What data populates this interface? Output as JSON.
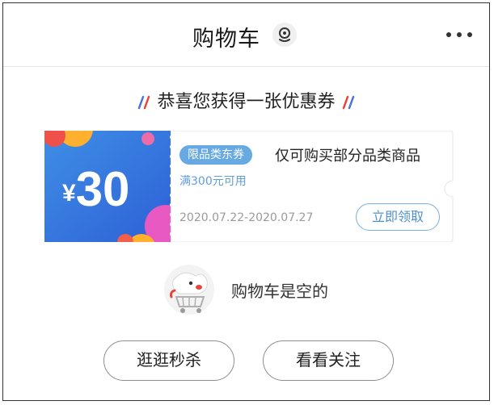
{
  "header": {
    "title": "购物车",
    "title_icon": "location-pin-icon",
    "more_icon": "more-dots-icon"
  },
  "banner": {
    "text": "恭喜您获得一张优惠券",
    "colors": {
      "red": "#e8453c",
      "blue": "#4a74d8"
    }
  },
  "coupon": {
    "currency_symbol": "¥",
    "amount": "30",
    "tag": "限品类东券",
    "description": "仅可购买部分品类商品",
    "condition": "满300元可用",
    "validity": "2020.07.22-2020.07.27",
    "claim_label": "立即领取",
    "colors": {
      "left_bg_start": "#3f8fe6",
      "left_bg_end": "#2d5fd6",
      "accent": "#66a9e3"
    }
  },
  "empty_cart": {
    "icon": "cart-mascot-icon",
    "text": "购物车是空的"
  },
  "actions": {
    "browse_label": "逛逛秒杀",
    "follow_label": "看看关注"
  }
}
